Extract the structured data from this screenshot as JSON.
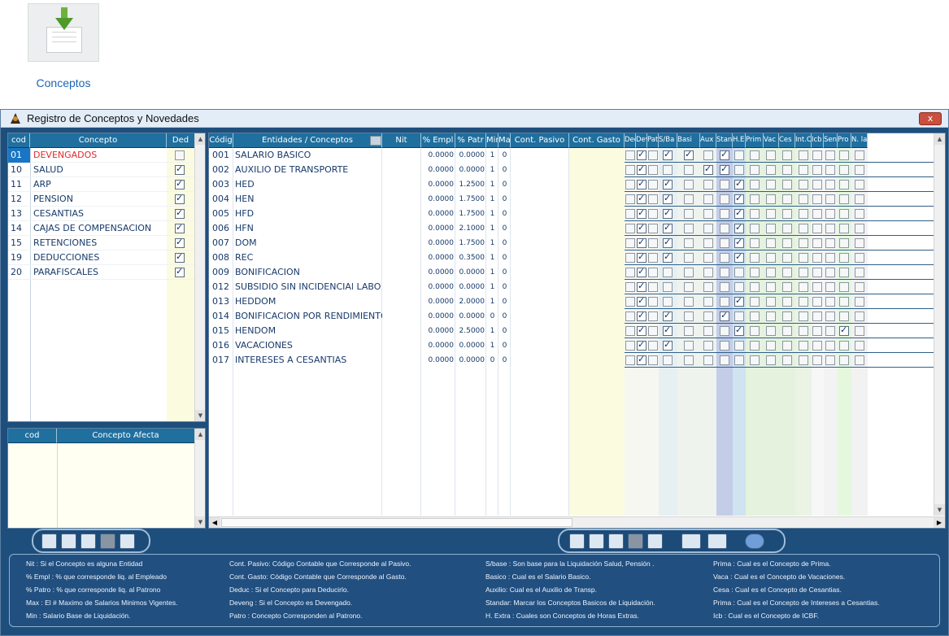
{
  "desktop_icon": {
    "label": "Conceptos"
  },
  "window": {
    "title": "Registro de Conceptos y Novedades",
    "close_label": "x"
  },
  "left_grid": {
    "headers": [
      "cod",
      "Concepto",
      "Ded"
    ],
    "rows": [
      {
        "cod": "01",
        "name": "DEVENGADOS",
        "ded": false,
        "selected": true
      },
      {
        "cod": "10",
        "name": "SALUD",
        "ded": true
      },
      {
        "cod": "11",
        "name": "ARP",
        "ded": true
      },
      {
        "cod": "12",
        "name": "PENSION",
        "ded": true
      },
      {
        "cod": "13",
        "name": "CESANTIAS",
        "ded": true
      },
      {
        "cod": "14",
        "name": "CAJAS DE COMPENSACION",
        "ded": true
      },
      {
        "cod": "15",
        "name": "RETENCIONES",
        "ded": true
      },
      {
        "cod": "19",
        "name": "DEDUCCIONES",
        "ded": true
      },
      {
        "cod": "20",
        "name": "PARAFISCALES",
        "ded": true
      }
    ]
  },
  "afecta_grid": {
    "headers": [
      "cod",
      "Concepto Afecta"
    ]
  },
  "main_grid": {
    "headers": [
      "Códig",
      "Entidades / Conceptos",
      "Nit",
      "% Empl",
      "% Patr",
      "Min",
      "Max",
      "Cont. Pasivo",
      "Cont. Gasto",
      "Ded",
      "Dev",
      "Pat",
      "S/Ba",
      "Basi",
      "Aux",
      "Stan",
      "H.E",
      "Prim",
      "Vac",
      "Ces",
      "Int.C",
      "Icb",
      "Sen",
      "Pro",
      "N. lab"
    ],
    "rows": [
      {
        "code": "001",
        "name": "SALARIO BASICO",
        "empl": "0.0000",
        "patr": "0.0000",
        "min": "1",
        "max": "0",
        "checks": [
          0,
          1,
          0,
          1,
          1,
          0,
          1,
          0,
          0,
          0,
          0,
          0,
          0,
          0,
          0,
          0
        ]
      },
      {
        "code": "002",
        "name": "AUXILIO DE TRANSPORTE",
        "empl": "0.0000",
        "patr": "0.0000",
        "min": "1",
        "max": "0",
        "checks": [
          0,
          1,
          0,
          0,
          0,
          1,
          1,
          0,
          0,
          0,
          0,
          0,
          0,
          0,
          0,
          0
        ]
      },
      {
        "code": "003",
        "name": "HED",
        "empl": "0.0000",
        "patr": "1.2500",
        "min": "1",
        "max": "0",
        "checks": [
          0,
          1,
          0,
          1,
          0,
          0,
          0,
          1,
          0,
          0,
          0,
          0,
          0,
          0,
          0,
          0
        ]
      },
      {
        "code": "004",
        "name": "HEN",
        "empl": "0.0000",
        "patr": "1.7500",
        "min": "1",
        "max": "0",
        "checks": [
          0,
          1,
          0,
          1,
          0,
          0,
          0,
          1,
          0,
          0,
          0,
          0,
          0,
          0,
          0,
          0
        ]
      },
      {
        "code": "005",
        "name": "HFD",
        "empl": "0.0000",
        "patr": "1.7500",
        "min": "1",
        "max": "0",
        "checks": [
          0,
          1,
          0,
          1,
          0,
          0,
          0,
          1,
          0,
          0,
          0,
          0,
          0,
          0,
          0,
          0
        ]
      },
      {
        "code": "006",
        "name": "HFN",
        "empl": "0.0000",
        "patr": "2.1000",
        "min": "1",
        "max": "0",
        "checks": [
          0,
          1,
          0,
          1,
          0,
          0,
          0,
          1,
          0,
          0,
          0,
          0,
          0,
          0,
          0,
          0
        ]
      },
      {
        "code": "007",
        "name": "DOM",
        "empl": "0.0000",
        "patr": "1.7500",
        "min": "1",
        "max": "0",
        "checks": [
          0,
          1,
          0,
          1,
          0,
          0,
          0,
          1,
          0,
          0,
          0,
          0,
          0,
          0,
          0,
          0
        ]
      },
      {
        "code": "008",
        "name": "REC",
        "empl": "0.0000",
        "patr": "0.3500",
        "min": "1",
        "max": "0",
        "checks": [
          0,
          1,
          0,
          1,
          0,
          0,
          0,
          1,
          0,
          0,
          0,
          0,
          0,
          0,
          0,
          0
        ]
      },
      {
        "code": "009",
        "name": "BONIFICACION",
        "empl": "0.0000",
        "patr": "0.0000",
        "min": "1",
        "max": "0",
        "checks": [
          0,
          1,
          0,
          0,
          0,
          0,
          0,
          0,
          0,
          0,
          0,
          0,
          0,
          0,
          0,
          0
        ]
      },
      {
        "code": "012",
        "name": "SUBSIDIO SIN INCIDENCIAl LABO",
        "empl": "0.0000",
        "patr": "0.0000",
        "min": "1",
        "max": "0",
        "checks": [
          0,
          1,
          0,
          0,
          0,
          0,
          0,
          0,
          0,
          0,
          0,
          0,
          0,
          0,
          0,
          0
        ]
      },
      {
        "code": "013",
        "name": "HEDDOM",
        "empl": "0.0000",
        "patr": "2.0000",
        "min": "1",
        "max": "0",
        "checks": [
          0,
          1,
          0,
          0,
          0,
          0,
          0,
          1,
          0,
          0,
          0,
          0,
          0,
          0,
          0,
          0
        ]
      },
      {
        "code": "014",
        "name": "BONIFICACION POR RENDIMIENTO",
        "empl": "0.0000",
        "patr": "0.0000",
        "min": "0",
        "max": "0",
        "checks": [
          0,
          1,
          0,
          1,
          0,
          0,
          1,
          0,
          0,
          0,
          0,
          0,
          0,
          0,
          0,
          0
        ]
      },
      {
        "code": "015",
        "name": "HENDOM",
        "empl": "0.0000",
        "patr": "2.5000",
        "min": "1",
        "max": "0",
        "checks": [
          0,
          1,
          0,
          1,
          0,
          0,
          0,
          1,
          0,
          0,
          0,
          0,
          0,
          0,
          1,
          0
        ]
      },
      {
        "code": "016",
        "name": "VACACIONES",
        "empl": "0.0000",
        "patr": "0.0000",
        "min": "1",
        "max": "0",
        "checks": [
          0,
          1,
          0,
          1,
          0,
          0,
          0,
          0,
          0,
          0,
          0,
          0,
          0,
          0,
          0,
          0
        ]
      },
      {
        "code": "017",
        "name": "INTERESES A CESANTIAS",
        "empl": "0.0000",
        "patr": "0.0000",
        "min": "0",
        "max": "0",
        "checks": [
          0,
          1,
          0,
          0,
          0,
          0,
          0,
          0,
          0,
          0,
          0,
          0,
          0,
          0,
          0,
          0
        ]
      }
    ]
  },
  "help": {
    "col1": [
      "Nit : Si el Concepto es alguna Entidad",
      "% Empl : % que corresponde liq. al Empleado",
      "% Patro : % que corresponde liq. al Patrono",
      "Max : El # Maximo de Salarios Minimos Vigentes.",
      "Min : Salario Base de Liquidación."
    ],
    "col2": [
      "Cont. Pasivo: Código Contable que Corresponde al Pasivo.",
      "Cont. Gasto: Código Contable que Corresponde al Gasto.",
      "Deduc : Si el Concepto para Deducirlo.",
      "Deveng : Si el Concepto es Devengado.",
      "Patro : Concepto Corresponden al Patrono."
    ],
    "col3": [
      "S/base : Son base para la Liquidación Salud, Pensión .",
      "Basico : Cual es el Salario Basico.",
      "Auxilio: Cual es el Auxilio de Transp.",
      "Standar: Marcar los Conceptos Basicos de Liquidación.",
      "H. Extra : Cuales son Conceptos de Horas Extras."
    ],
    "col4": [
      "Prima : Cual es el Concepto de Prima.",
      "Vaca : Cual es el Concepto de Vacaciones.",
      "Cesa : Cual es el Concepto de Cesantias.",
      "Prima : Cual es el Concepto de Intereses a Cesantias.",
      "Icb : Cual es el Concepto de ICBF."
    ]
  },
  "colors": {
    "header": "#1f6f9f",
    "window": "#1e4e7c",
    "selected": "#1a76c4",
    "devengados": "#e02a2a"
  }
}
